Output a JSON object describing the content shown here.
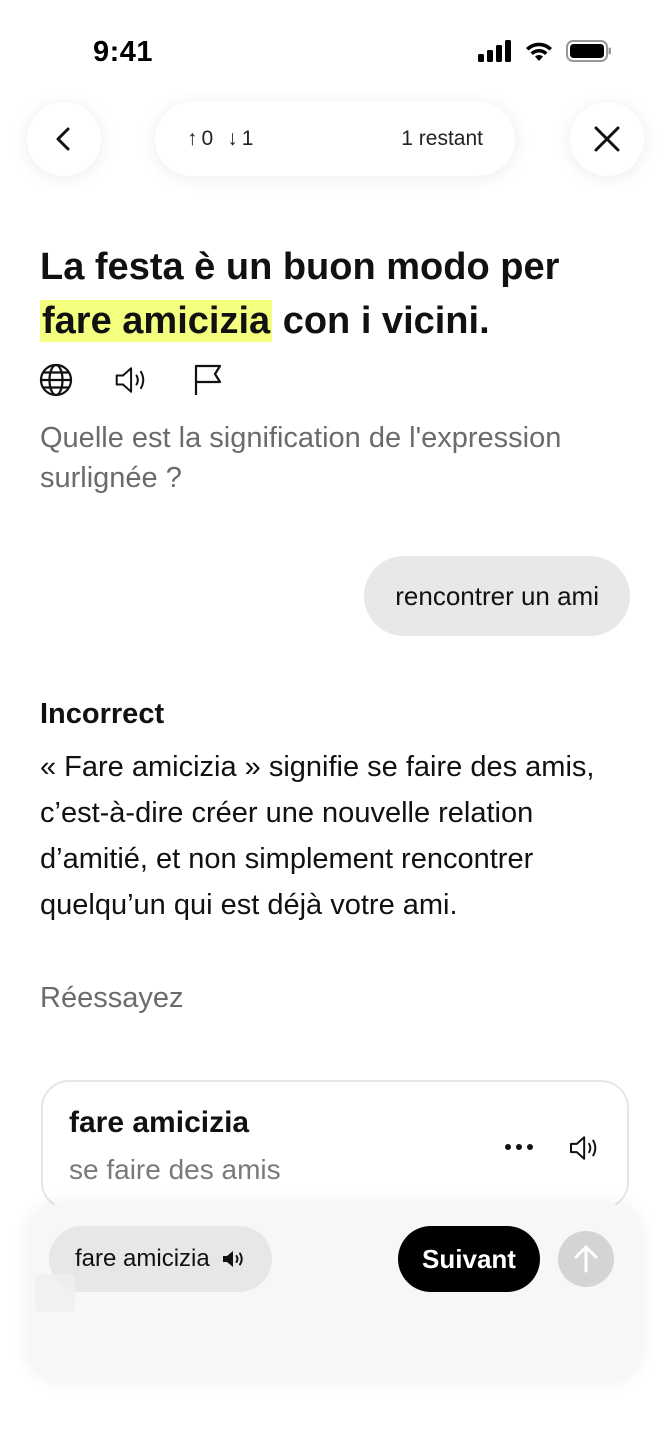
{
  "status_bar": {
    "time": "9:41"
  },
  "progress": {
    "up_count": "0",
    "down_count": "1",
    "remaining": "1 restant"
  },
  "exercise": {
    "sentence_before": "La festa è un buon modo per ",
    "sentence_highlight": "fare amicizia",
    "sentence_after": " con i vicini.",
    "question": "Quelle est la signification de l'expression surlignée ?",
    "highlight_color": "#f4ff7f"
  },
  "answer": {
    "text": "rencontrer un ami"
  },
  "feedback": {
    "title": "Incorrect",
    "explanation": "« Fare amicizia » signifie se faire des amis, c’est-à-dire créer une nouvelle relation d’amitié, et non simplement rencontrer quelqu’un qui est déjà votre ami.",
    "retry": "Réessayez"
  },
  "vocab": {
    "term": "fare amicizia",
    "definition": "se faire des amis"
  },
  "bottom_bar": {
    "phrase_chip": "fare amicizia",
    "next_label": "Suivant"
  },
  "icons": {
    "back": "chevron-left-icon",
    "close": "close-icon",
    "translate": "globe-icon",
    "audio": "speaker-icon",
    "report": "flag-icon",
    "more": "more-dots-icon",
    "send": "arrow-up-icon"
  }
}
